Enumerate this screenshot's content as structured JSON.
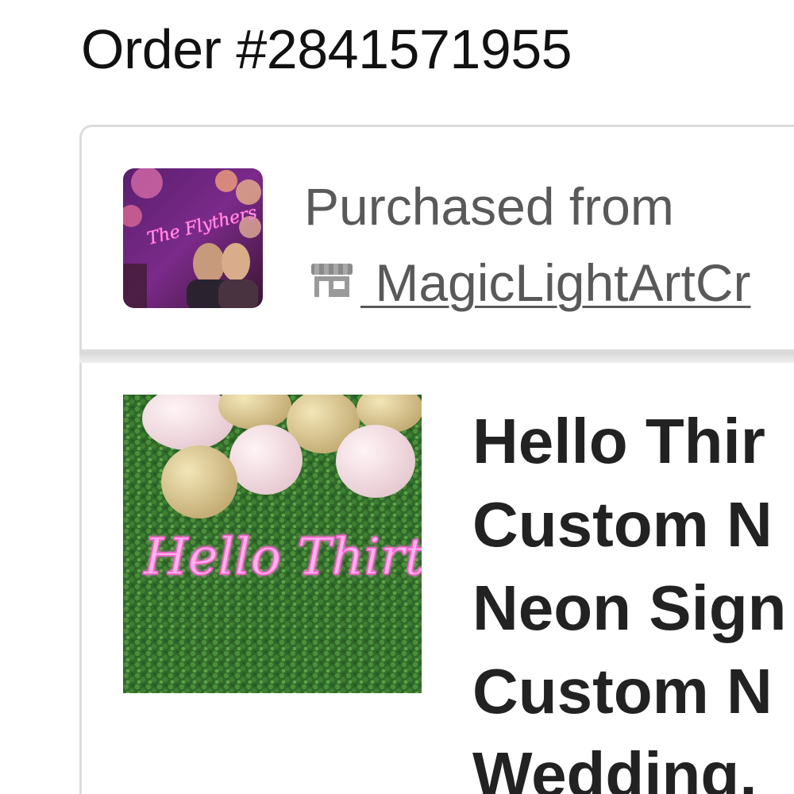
{
  "order": {
    "title": "Order #2841571955"
  },
  "shop": {
    "purchased_label": "Purchased from",
    "shop_name": " MagicLightArtCr",
    "icon": "store-icon",
    "thumb_sign_text": "The Flythers"
  },
  "item": {
    "title": "Hello Thir\nCustom N\nNeon Sign\nCustom N\nWedding,",
    "image_sign_text": "Hello Thirty"
  },
  "colors": {
    "neon_pink": "#ff5fd2",
    "border": "#dcdcdc",
    "muted_text": "#595959"
  }
}
